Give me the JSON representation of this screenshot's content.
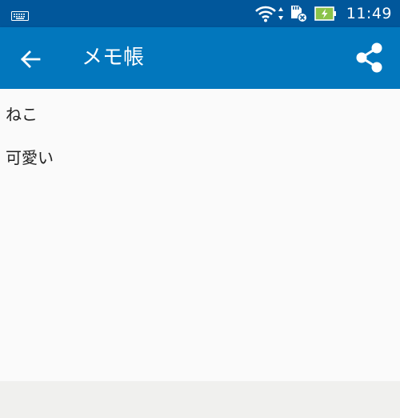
{
  "status_bar": {
    "time": "11:49",
    "icons": [
      "keyboard-icon",
      "wifi-icon",
      "data-arrows-icon",
      "sd-card-icon",
      "battery-charging-icon"
    ]
  },
  "app_bar": {
    "title": "メモ帳",
    "back_icon": "arrow-left-icon",
    "share_icon": "share-icon"
  },
  "memo": {
    "lines": [
      "ねこ",
      "可愛い"
    ]
  },
  "colors": {
    "status_bar": "#01579b",
    "app_bar": "#0277bd",
    "background": "#fafafa",
    "text": "#222222",
    "battery": "#8bc34a"
  }
}
